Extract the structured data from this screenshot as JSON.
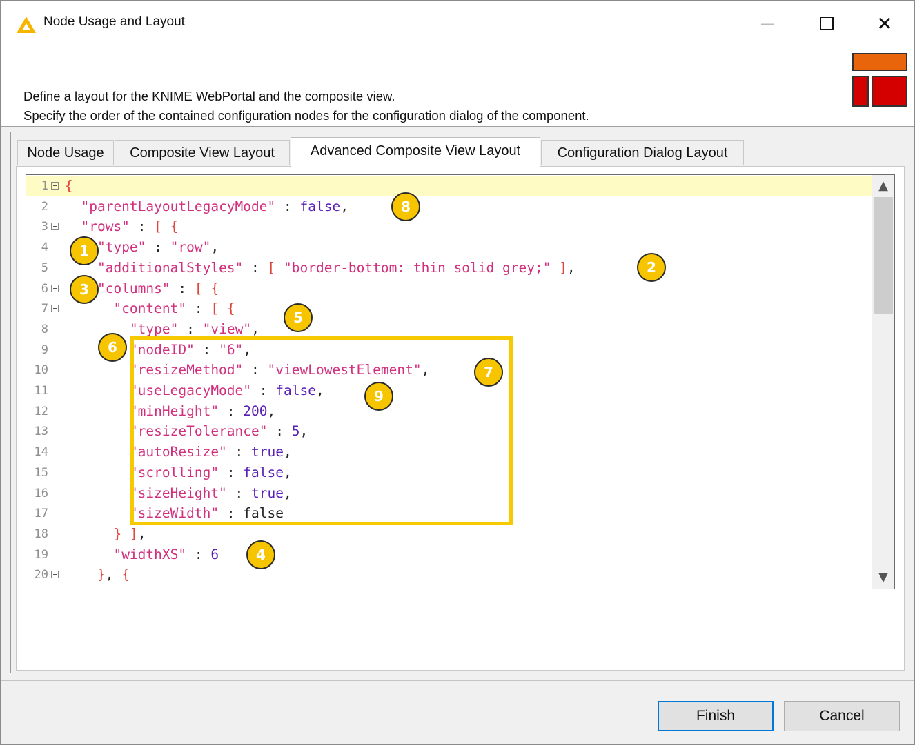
{
  "window": {
    "title": "Node Usage and Layout"
  },
  "header": {
    "line1": "Define a layout for the KNIME WebPortal and the composite view.",
    "line2": "Specify the order of the contained configuration nodes for the configuration dialog of the component."
  },
  "tabs": [
    {
      "label": "Node Usage",
      "active": false
    },
    {
      "label": "Composite View Layout",
      "active": false
    },
    {
      "label": "Advanced Composite View Layout",
      "active": true
    },
    {
      "label": "Configuration Dialog Layout",
      "active": false
    }
  ],
  "editor": {
    "lines": [
      {
        "n": "1",
        "fold": true,
        "tokens": [
          [
            "b",
            "{"
          ]
        ]
      },
      {
        "n": "2",
        "fold": false,
        "tokens": [
          [
            "p",
            "  "
          ],
          [
            "k",
            "\"parentLayoutLegacyMode\""
          ],
          [
            "p",
            " : "
          ],
          [
            "v",
            "false"
          ],
          [
            "p",
            ","
          ]
        ]
      },
      {
        "n": "3",
        "fold": true,
        "tokens": [
          [
            "p",
            "  "
          ],
          [
            "k",
            "\"rows\""
          ],
          [
            "p",
            " : "
          ],
          [
            "b",
            "[ {"
          ]
        ]
      },
      {
        "n": "4",
        "fold": false,
        "tokens": [
          [
            "p",
            "    "
          ],
          [
            "k",
            "\"type\""
          ],
          [
            "p",
            " : "
          ],
          [
            "s",
            "\"row\""
          ],
          [
            "p",
            ","
          ]
        ]
      },
      {
        "n": "5",
        "fold": false,
        "tokens": [
          [
            "p",
            "    "
          ],
          [
            "k",
            "\"additionalStyles\""
          ],
          [
            "p",
            " : "
          ],
          [
            "b",
            "[ "
          ],
          [
            "s",
            "\"border-bottom: thin solid grey;\""
          ],
          [
            "b",
            " ]"
          ],
          [
            "p",
            ","
          ]
        ]
      },
      {
        "n": "6",
        "fold": true,
        "tokens": [
          [
            "p",
            "    "
          ],
          [
            "k",
            "\"columns\""
          ],
          [
            "p",
            " : "
          ],
          [
            "b",
            "[ {"
          ]
        ]
      },
      {
        "n": "7",
        "fold": true,
        "tokens": [
          [
            "p",
            "      "
          ],
          [
            "k",
            "\"content\""
          ],
          [
            "p",
            " : "
          ],
          [
            "b",
            "[ {"
          ]
        ]
      },
      {
        "n": "8",
        "fold": false,
        "tokens": [
          [
            "p",
            "        "
          ],
          [
            "k",
            "\"type\""
          ],
          [
            "p",
            " : "
          ],
          [
            "s",
            "\"view\""
          ],
          [
            "p",
            ","
          ]
        ]
      },
      {
        "n": "9",
        "fold": false,
        "tokens": [
          [
            "p",
            "        "
          ],
          [
            "k",
            "\"nodeID\""
          ],
          [
            "p",
            " : "
          ],
          [
            "s",
            "\"6\""
          ],
          [
            "p",
            ","
          ]
        ]
      },
      {
        "n": "10",
        "fold": false,
        "tokens": [
          [
            "p",
            "        "
          ],
          [
            "k",
            "\"resizeMethod\""
          ],
          [
            "p",
            " : "
          ],
          [
            "s",
            "\"viewLowestElement\""
          ],
          [
            "p",
            ","
          ]
        ]
      },
      {
        "n": "11",
        "fold": false,
        "tokens": [
          [
            "p",
            "        "
          ],
          [
            "k",
            "\"useLegacyMode\""
          ],
          [
            "p",
            " : "
          ],
          [
            "v",
            "false"
          ],
          [
            "p",
            ","
          ]
        ]
      },
      {
        "n": "12",
        "fold": false,
        "tokens": [
          [
            "p",
            "        "
          ],
          [
            "k",
            "\"minHeight\""
          ],
          [
            "p",
            " : "
          ],
          [
            "v",
            "200"
          ],
          [
            "p",
            ","
          ]
        ]
      },
      {
        "n": "13",
        "fold": false,
        "tokens": [
          [
            "p",
            "        "
          ],
          [
            "k",
            "\"resizeTolerance\""
          ],
          [
            "p",
            " : "
          ],
          [
            "v",
            "5"
          ],
          [
            "p",
            ","
          ]
        ]
      },
      {
        "n": "14",
        "fold": false,
        "tokens": [
          [
            "p",
            "        "
          ],
          [
            "k",
            "\"autoResize\""
          ],
          [
            "p",
            " : "
          ],
          [
            "v",
            "true"
          ],
          [
            "p",
            ","
          ]
        ]
      },
      {
        "n": "15",
        "fold": false,
        "tokens": [
          [
            "p",
            "        "
          ],
          [
            "k",
            "\"scrolling\""
          ],
          [
            "p",
            " : "
          ],
          [
            "v",
            "false"
          ],
          [
            "p",
            ","
          ]
        ]
      },
      {
        "n": "16",
        "fold": false,
        "tokens": [
          [
            "p",
            "        "
          ],
          [
            "k",
            "\"sizeHeight\""
          ],
          [
            "p",
            " : "
          ],
          [
            "v",
            "true"
          ],
          [
            "p",
            ","
          ]
        ]
      },
      {
        "n": "17",
        "fold": false,
        "tokens": [
          [
            "p",
            "        "
          ],
          [
            "k",
            "\"sizeWidth\""
          ],
          [
            "p",
            " : "
          ],
          [
            "n",
            "false"
          ]
        ]
      },
      {
        "n": "18",
        "fold": false,
        "tokens": [
          [
            "p",
            "      "
          ],
          [
            "b",
            "} ]"
          ],
          [
            "p",
            ","
          ]
        ]
      },
      {
        "n": "19",
        "fold": false,
        "tokens": [
          [
            "p",
            "      "
          ],
          [
            "k",
            "\"widthXS\""
          ],
          [
            "p",
            " : "
          ],
          [
            "v",
            "6"
          ]
        ]
      },
      {
        "n": "20",
        "fold": true,
        "tokens": [
          [
            "p",
            "    "
          ],
          [
            "b",
            "}"
          ],
          [
            "p",
            ", "
          ],
          [
            "b",
            "{"
          ]
        ]
      }
    ]
  },
  "badges": [
    "1",
    "2",
    "3",
    "4",
    "5",
    "6",
    "7",
    "8",
    "9"
  ],
  "buttons": {
    "finish": "Finish",
    "cancel": "Cancel"
  },
  "icons": {
    "scroll_up": "▲",
    "scroll_down": "▼",
    "close": "✕"
  },
  "colors": {
    "key": "#d0307d",
    "bracket": "#e0453c",
    "value": "#5a1fb4",
    "highlight": "#f7c900",
    "badge": "#f7c500"
  }
}
